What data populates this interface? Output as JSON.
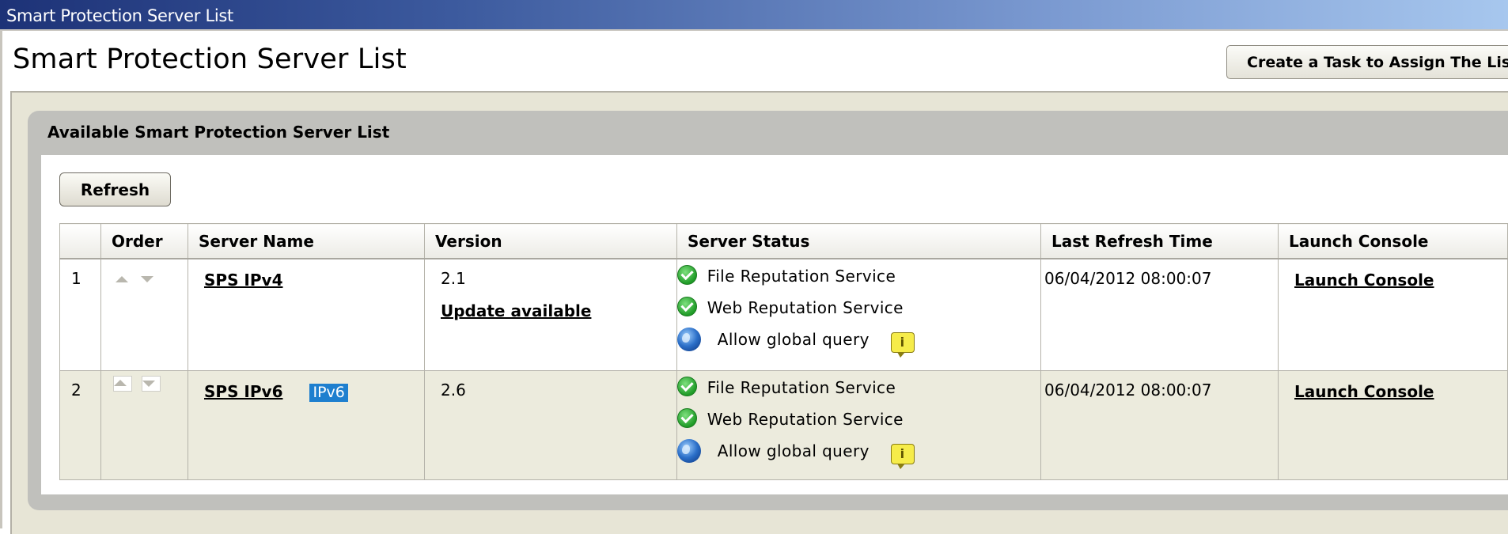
{
  "window": {
    "title": "Smart Protection Server List"
  },
  "header": {
    "page_title": "Smart Protection Server List",
    "create_task_label": "Create a Task to Assign The List"
  },
  "panel": {
    "title": "Available Smart Protection Server List",
    "refresh_label": "Refresh"
  },
  "table": {
    "columns": [
      "",
      "Order",
      "Server Name",
      "Version",
      "Server Status",
      "Last Refresh Time",
      "Launch Console"
    ],
    "rows": [
      {
        "index": "1",
        "server_name": "SPS IPv4",
        "badge": "",
        "version": "2.1",
        "update_link": "Update available",
        "statuses": [
          "File Reputation Service",
          "Web Reputation Service",
          "Allow global query"
        ],
        "last_refresh": "06/04/2012 08:00:07",
        "launch": "Launch Console"
      },
      {
        "index": "2",
        "server_name": "SPS IPv6",
        "badge": "IPv6",
        "version": "2.6",
        "update_link": "",
        "statuses": [
          "File Reputation Service",
          "Web Reputation Service",
          "Allow global query"
        ],
        "last_refresh": "06/04/2012 08:00:07",
        "launch": "Launch Console"
      }
    ]
  },
  "icons": {
    "status_ok": "green-check-icon",
    "global": "globe-icon",
    "info": "info-icon",
    "info_glyph": "i"
  },
  "colors": {
    "titlebar_start": "#1d3277",
    "titlebar_end": "#a7c7ee",
    "badge": "#1e7fcf",
    "row_alt": "#ecebdd",
    "panel_bg": "#e7e5d6"
  }
}
